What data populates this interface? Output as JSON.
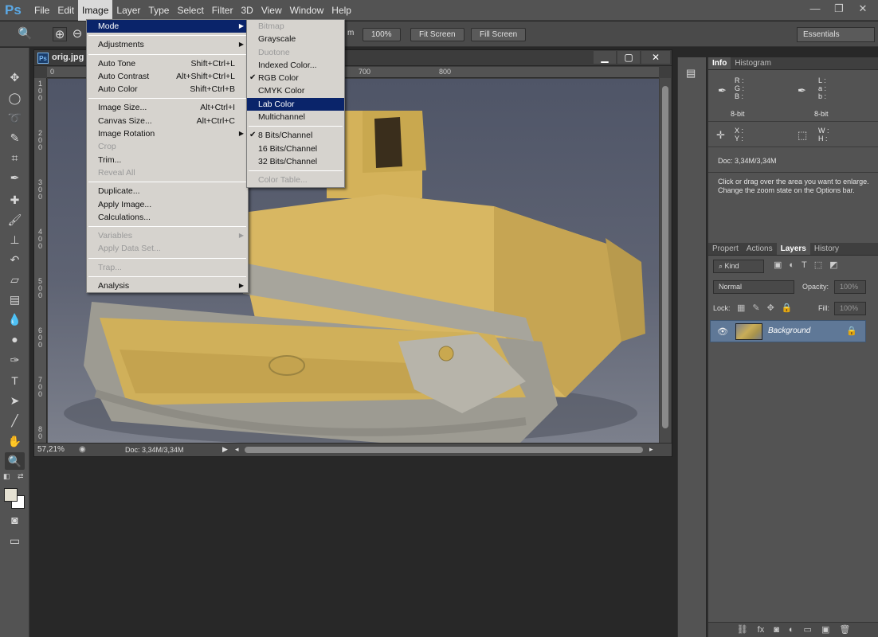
{
  "app": {
    "logo": "Ps"
  },
  "menubar": {
    "items": [
      "File",
      "Edit",
      "Image",
      "Layer",
      "Type",
      "Select",
      "Filter",
      "3D",
      "View",
      "Window",
      "Help"
    ],
    "active": "Image"
  },
  "window_controls": {
    "minimize": "—",
    "restore": "❐",
    "close": "✕"
  },
  "options": {
    "zoom_fragment": "m",
    "pct_button": "100%",
    "fit_screen": "Fit Screen",
    "fill_screen": "Fill Screen",
    "workspace": "Essentials"
  },
  "document": {
    "title": "orig.jpg",
    "icon": "Ps",
    "zoom": "57,21%",
    "status": "Doc: 3,34M/3,34M",
    "ruler_top": [
      "0",
      "700",
      "800"
    ],
    "ruler_left": [
      "1",
      "0",
      "0",
      "2",
      "0",
      "0",
      "3",
      "0",
      "0",
      "4",
      "0",
      "0",
      "5",
      "0",
      "0",
      "6",
      "0",
      "0",
      "7",
      "0",
      "0",
      "8",
      "0"
    ]
  },
  "image_menu": {
    "items": [
      {
        "label": "Mode",
        "submenu": true,
        "selected": true
      },
      {
        "sep": true
      },
      {
        "label": "Adjustments",
        "submenu": true
      },
      {
        "sep": true
      },
      {
        "label": "Auto Tone",
        "shortcut": "Shift+Ctrl+L"
      },
      {
        "label": "Auto Contrast",
        "shortcut": "Alt+Shift+Ctrl+L"
      },
      {
        "label": "Auto Color",
        "shortcut": "Shift+Ctrl+B"
      },
      {
        "sep": true
      },
      {
        "label": "Image Size...",
        "shortcut": "Alt+Ctrl+I"
      },
      {
        "label": "Canvas Size...",
        "shortcut": "Alt+Ctrl+C"
      },
      {
        "label": "Image Rotation",
        "submenu": true
      },
      {
        "label": "Crop",
        "disabled": true
      },
      {
        "label": "Trim..."
      },
      {
        "label": "Reveal All",
        "disabled": true
      },
      {
        "sep": true
      },
      {
        "label": "Duplicate..."
      },
      {
        "label": "Apply Image..."
      },
      {
        "label": "Calculations..."
      },
      {
        "sep": true
      },
      {
        "label": "Variables",
        "submenu": true,
        "disabled": true
      },
      {
        "label": "Apply Data Set...",
        "disabled": true
      },
      {
        "sep": true
      },
      {
        "label": "Trap...",
        "disabled": true
      },
      {
        "sep": true
      },
      {
        "label": "Analysis",
        "submenu": true
      }
    ]
  },
  "mode_menu": {
    "items": [
      {
        "label": "Bitmap",
        "disabled": true
      },
      {
        "label": "Grayscale"
      },
      {
        "label": "Duotone",
        "disabled": true
      },
      {
        "label": "Indexed Color..."
      },
      {
        "label": "RGB Color",
        "checked": true
      },
      {
        "label": "CMYK Color"
      },
      {
        "label": "Lab Color",
        "selected": true
      },
      {
        "label": "Multichannel"
      },
      {
        "sep": true
      },
      {
        "label": "8 Bits/Channel",
        "checked": true
      },
      {
        "label": "16 Bits/Channel"
      },
      {
        "label": "32 Bits/Channel"
      },
      {
        "sep": true
      },
      {
        "label": "Color Table...",
        "disabled": true
      }
    ]
  },
  "info_panel": {
    "tabs": [
      "Info",
      "Histogram"
    ],
    "active_tab": "Info",
    "rgb_labels": "R :\nG :\nB :",
    "lab_labels": "L :\na :\nb :",
    "bit_left": "8-bit",
    "bit_right": "8-bit",
    "xy_labels": "X :\nY :",
    "wh_labels": "W :\nH :",
    "doc": "Doc: 3,34M/3,34M",
    "help": "Click or drag over the area you want to enlarge. Change the zoom state on the Options bar."
  },
  "layers_panel": {
    "tabs": [
      "Propert",
      "Actions",
      "Layers",
      "History"
    ],
    "active_tab": "Layers",
    "filter": "Kind",
    "blend_mode": "Normal",
    "opacity_label": "Opacity:",
    "opacity_value": "100%",
    "lock_label": "Lock:",
    "fill_label": "Fill:",
    "fill_value": "100%",
    "layer_name": "Background"
  }
}
